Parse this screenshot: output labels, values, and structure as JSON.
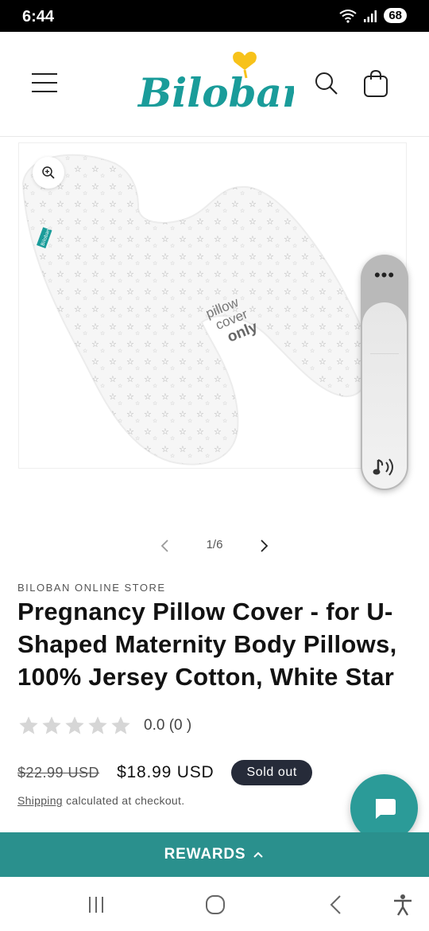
{
  "status_bar": {
    "time": "6:44",
    "battery": "68"
  },
  "header": {
    "logo_text": "Biloban",
    "brand_color": "#1a9c9a",
    "accent_color": "#f7c21a"
  },
  "gallery": {
    "image_caption_lines": [
      "pillow",
      "cover",
      "only"
    ],
    "tag_text": "Biloban"
  },
  "pager": {
    "count": "1/6"
  },
  "product": {
    "vendor": "BILOBAN ONLINE STORE",
    "title": "Pregnancy Pillow Cover - for U-Shaped Maternity Body Pillows, 100% Jersey Cotton, White Star",
    "rating_value": 0,
    "rating_max": 5,
    "rating_text": "0.0 (0 )",
    "old_price": "$22.99 USD",
    "price": "$18.99 USD",
    "badge": "Sold out",
    "shipping_link": "Shipping",
    "shipping_text": " calculated at checkout."
  },
  "rewards": {
    "label": "REWARDS"
  },
  "colors": {
    "rewards_bg": "#2a908d",
    "chat_bg": "#2b9b98",
    "badge_bg": "#262b39"
  },
  "icons": [
    "menu-icon",
    "search-icon",
    "cart-icon",
    "zoom-icon",
    "more-icon",
    "sound-icon",
    "chevron-left-icon",
    "chevron-right-icon",
    "chat-icon",
    "chevron-up-icon",
    "recent-apps-icon",
    "home-icon",
    "back-icon",
    "accessibility-icon"
  ]
}
